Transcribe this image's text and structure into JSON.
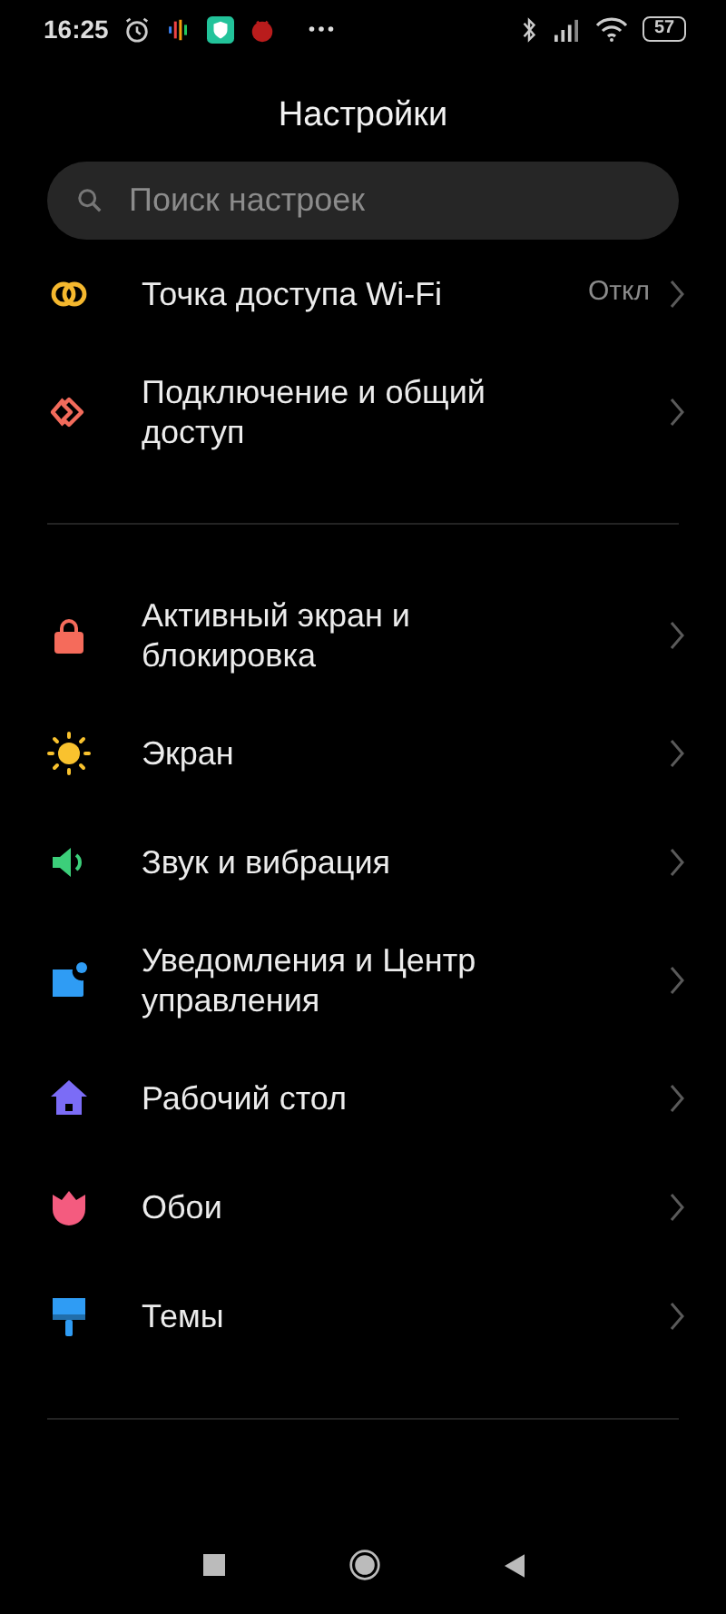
{
  "status_bar": {
    "time": "16:25",
    "battery": "57"
  },
  "title": "Настройки",
  "search": {
    "placeholder": "Поиск настроек"
  },
  "sections": [
    {
      "items": [
        {
          "kind": "hotspot",
          "label": "Точка доступа Wi-Fi",
          "value": "Откл"
        },
        {
          "kind": "share",
          "label": "Подключение и общий доступ"
        }
      ]
    },
    {
      "items": [
        {
          "kind": "lock",
          "label": "Активный экран и блокировка"
        },
        {
          "kind": "sun",
          "label": "Экран"
        },
        {
          "kind": "sound",
          "label": "Звук и вибрация"
        },
        {
          "kind": "notification",
          "label": "Уведомления и Центр управления"
        },
        {
          "kind": "home",
          "label": "Рабочий стол"
        },
        {
          "kind": "flower",
          "label": "Обои"
        },
        {
          "kind": "brush",
          "label": "Темы"
        }
      ]
    }
  ]
}
